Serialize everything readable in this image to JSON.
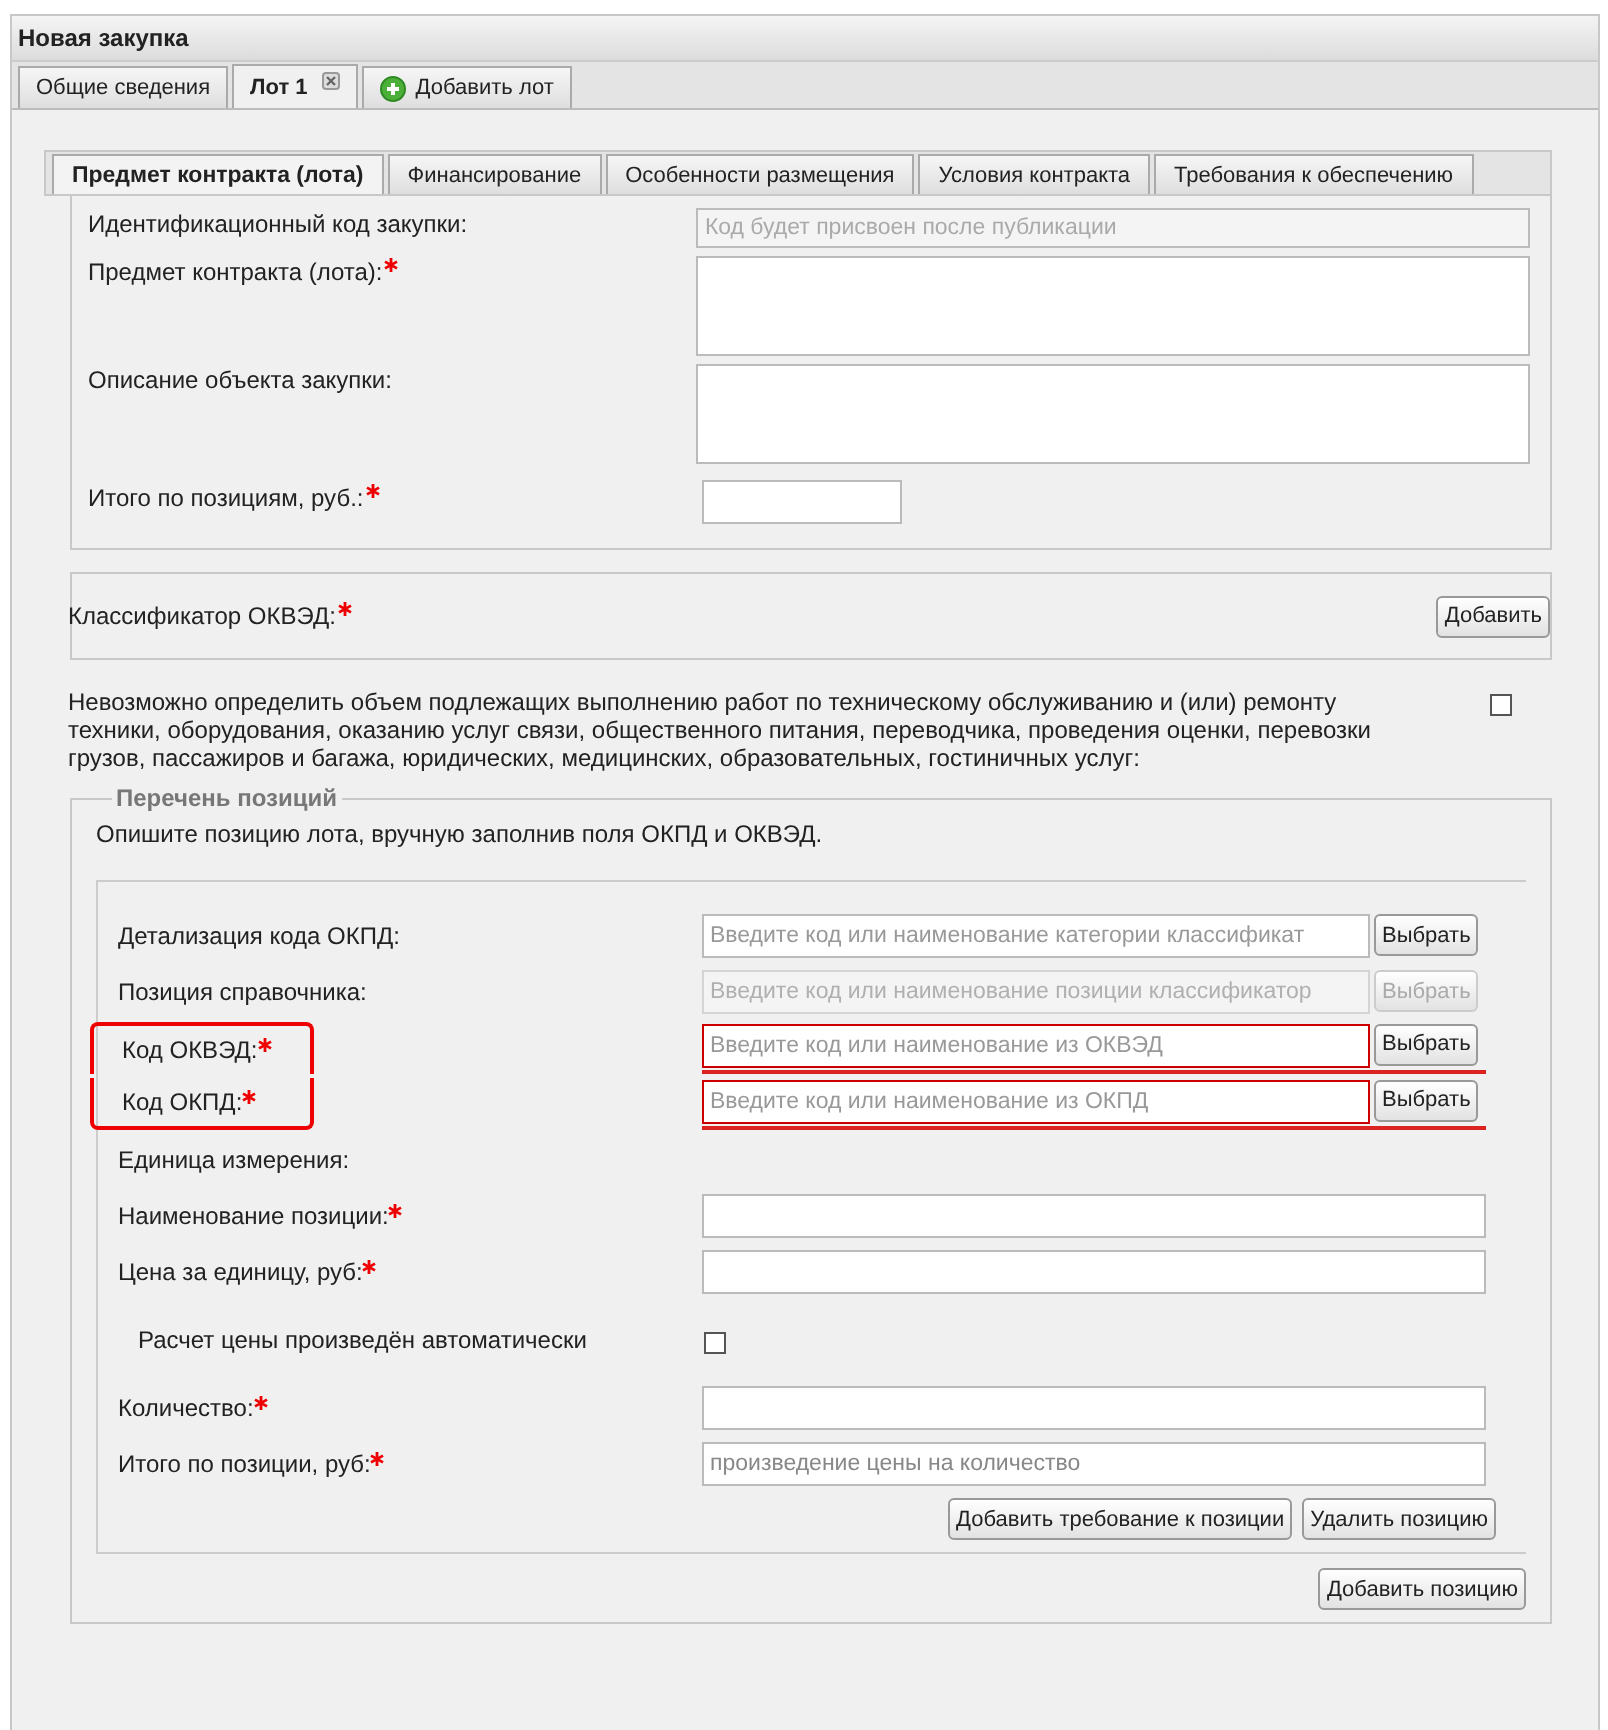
{
  "window": {
    "title": "Новая закупка"
  },
  "top_tabs": [
    {
      "label": "Общие сведения",
      "selected": false,
      "closable": false,
      "kind": "tab"
    },
    {
      "label": "Лот 1",
      "selected": true,
      "closable": true,
      "kind": "tab"
    },
    {
      "label": "Добавить лот",
      "selected": false,
      "kind": "add"
    }
  ],
  "lot_tabs": [
    {
      "label": "Предмет контракта (лота)",
      "selected": true
    },
    {
      "label": "Финансирование",
      "selected": false
    },
    {
      "label": "Особенности размещения",
      "selected": false
    },
    {
      "label": "Условия контракта",
      "selected": false
    },
    {
      "label": "Требования к обеспечению",
      "selected": false
    }
  ],
  "subject_fields": [
    {
      "label": "Идентификационный код закупки:",
      "required": false,
      "kind": "readonly",
      "placeholder": "Код будет присвоен после публикации"
    },
    {
      "label": "Предмет контракта (лота):",
      "required": true,
      "kind": "textarea"
    },
    {
      "label": "Описание объекта закупки:",
      "required": false,
      "kind": "textarea"
    },
    {
      "label": "Итого по позициям, руб.:",
      "required": true,
      "kind": "short"
    }
  ],
  "classifier": {
    "label": "Классификатор ОКВЭД:",
    "required": true,
    "button": "Добавить"
  },
  "exemption": {
    "text": "Невозможно определить объем подлежащих выполнению работ по техническому обслуживанию и (или) ремонту техники, оборудования, оказанию услуг связи, общественного питания, переводчика, проведения оценки, перевозки грузов, пассажиров и багажа, юридических, медицинских, образовательных, гостиничных услуг:",
    "checked": false
  },
  "positions": {
    "legend": "Перечень позиций",
    "hint": "Опишите позицию лота, вручную заполнив поля ОКПД и ОКВЭД.",
    "rows": [
      {
        "kind": "lookup",
        "label": "Детализация кода ОКПД:",
        "required": false,
        "placeholder": "Введите код или наименование категории классификат",
        "button": "Выбрать",
        "disabled": false,
        "invalid": false,
        "highlighted": false
      },
      {
        "kind": "lookup",
        "label": "Позиция справочника:",
        "required": false,
        "placeholder": "Введите код или наименование позиции классификатор",
        "button": "Выбрать",
        "disabled": true,
        "invalid": false,
        "highlighted": false
      },
      {
        "kind": "lookup",
        "label": "Код ОКВЭД:",
        "required": true,
        "placeholder": "Введите код или наименование из ОКВЭД",
        "button": "Выбрать",
        "disabled": false,
        "invalid": true,
        "highlighted": true
      },
      {
        "kind": "lookup",
        "label": "Код ОКПД:",
        "required": true,
        "placeholder": "Введите код или наименование из ОКПД",
        "button": "Выбрать",
        "disabled": false,
        "invalid": true,
        "highlighted": true
      },
      {
        "kind": "label",
        "label": "Единица измерения:",
        "required": false,
        "highlighted": false
      },
      {
        "kind": "text",
        "label": "Наименование позиции:",
        "required": true,
        "highlighted": false
      },
      {
        "kind": "text",
        "label": "Цена за единицу, руб:",
        "required": true,
        "highlighted": false
      },
      {
        "kind": "checkbox",
        "label": "Расчет цены произведён автоматически",
        "checked": false,
        "highlighted": false
      },
      {
        "kind": "text",
        "label": "Количество:",
        "required": true,
        "highlighted": false
      },
      {
        "kind": "text",
        "label": "Итого по позиции, руб:",
        "required": true,
        "placeholder": "произведение цены на количество",
        "highlighted": false
      }
    ],
    "row_buttons": [
      "Добавить требование к позиции",
      "Удалить позицию"
    ],
    "add_button": "Добавить позицию"
  }
}
